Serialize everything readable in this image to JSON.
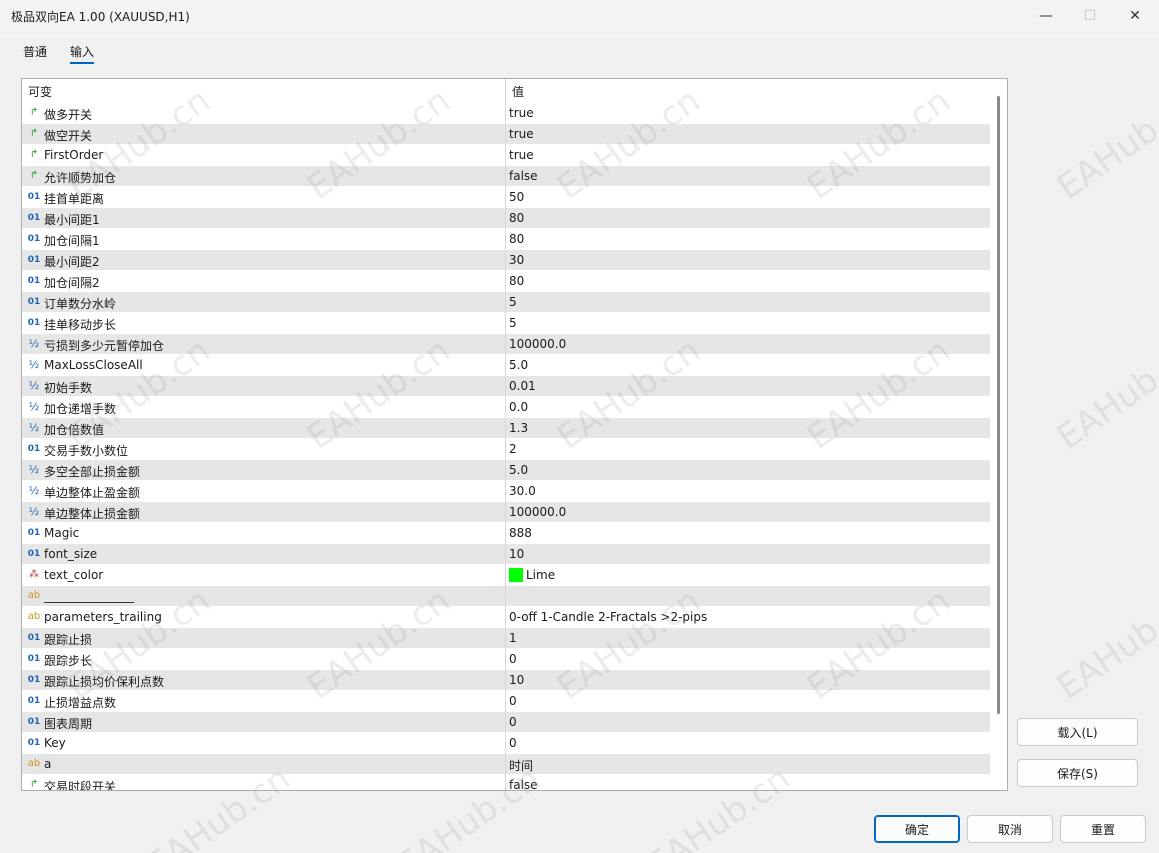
{
  "window": {
    "title": "极品双向EA 1.00 (XAUUSD,H1)",
    "minimize_glyph": "—",
    "maximize_glyph": "☐",
    "close_glyph": "✕"
  },
  "tabs": [
    {
      "label": "普通",
      "active": false
    },
    {
      "label": "输入",
      "active": true
    }
  ],
  "table": {
    "headers": {
      "name": "可变",
      "value": "值"
    },
    "rows": [
      {
        "icon": "bool-icon",
        "glyph": "↱",
        "name": "做多开关",
        "value": "true"
      },
      {
        "icon": "bool-icon",
        "glyph": "↱",
        "name": "做空开关",
        "value": "true"
      },
      {
        "icon": "bool-icon",
        "glyph": "↱",
        "name": "FirstOrder",
        "value": "true"
      },
      {
        "icon": "bool-icon",
        "glyph": "↱",
        "name": "允许顺势加仓",
        "value": "false"
      },
      {
        "icon": "int-icon",
        "glyph": "01",
        "name": "挂首单距离",
        "value": "50"
      },
      {
        "icon": "int-icon",
        "glyph": "01",
        "name": "最小间距1",
        "value": "80"
      },
      {
        "icon": "int-icon",
        "glyph": "01",
        "name": "加仓间隔1",
        "value": "80"
      },
      {
        "icon": "int-icon",
        "glyph": "01",
        "name": "最小间距2",
        "value": "30"
      },
      {
        "icon": "int-icon",
        "glyph": "01",
        "name": "加仓间隔2",
        "value": "80"
      },
      {
        "icon": "int-icon",
        "glyph": "01",
        "name": "订单数分水岭",
        "value": "5"
      },
      {
        "icon": "int-icon",
        "glyph": "01",
        "name": "挂单移动步长",
        "value": "5"
      },
      {
        "icon": "double-icon",
        "glyph": "½",
        "name": "亏损到多少元暂停加仓",
        "value": "100000.0"
      },
      {
        "icon": "double-icon",
        "glyph": "½",
        "name": "MaxLossCloseAll",
        "value": "5.0"
      },
      {
        "icon": "double-icon",
        "glyph": "½",
        "name": "初始手数",
        "value": "0.01"
      },
      {
        "icon": "double-icon",
        "glyph": "½",
        "name": "加仓递增手数",
        "value": "0.0"
      },
      {
        "icon": "double-icon",
        "glyph": "½",
        "name": "加仓倍数值",
        "value": "1.3"
      },
      {
        "icon": "int-icon",
        "glyph": "01",
        "name": "交易手数小数位",
        "value": "2"
      },
      {
        "icon": "double-icon",
        "glyph": "½",
        "name": "多空全部止损金额",
        "value": "5.0"
      },
      {
        "icon": "double-icon",
        "glyph": "½",
        "name": "单边整体止盈金额",
        "value": "30.0"
      },
      {
        "icon": "double-icon",
        "glyph": "½",
        "name": "单边整体止损金额",
        "value": "100000.0"
      },
      {
        "icon": "int-icon",
        "glyph": "01",
        "name": "Magic",
        "value": "888"
      },
      {
        "icon": "int-icon",
        "glyph": "01",
        "name": "font_size",
        "value": "10"
      },
      {
        "icon": "color-icon",
        "glyph": "⁂",
        "name": "text_color",
        "value": "Lime",
        "swatch": "#00ff00"
      },
      {
        "icon": "string-icon",
        "glyph": "ab",
        "name": "_______________",
        "value": ""
      },
      {
        "icon": "string-icon",
        "glyph": "ab",
        "name": "parameters_trailing",
        "value": "0-off  1-Candle  2-Fractals  >2-pips"
      },
      {
        "icon": "int-icon",
        "glyph": "01",
        "name": "跟踪止损",
        "value": "1"
      },
      {
        "icon": "int-icon",
        "glyph": "01",
        "name": "跟踪步长",
        "value": "0"
      },
      {
        "icon": "int-icon",
        "glyph": "01",
        "name": "跟踪止损均价保利点数",
        "value": "10"
      },
      {
        "icon": "int-icon",
        "glyph": "01",
        "name": "止损增益点数",
        "value": "0"
      },
      {
        "icon": "int-icon",
        "glyph": "01",
        "name": "图表周期",
        "value": "0"
      },
      {
        "icon": "int-icon",
        "glyph": "01",
        "name": "Key",
        "value": "0"
      },
      {
        "icon": "string-icon",
        "glyph": "ab",
        "name": "a",
        "value": "时间"
      },
      {
        "icon": "bool-icon",
        "glyph": "↱",
        "name": "交易时段开关",
        "value": "false"
      }
    ]
  },
  "buttons": {
    "load": "载入(L)",
    "save": "保存(S)",
    "ok": "确定",
    "cancel": "取消",
    "reset": "重置"
  },
  "watermark": "EAHub.cn",
  "colors": {
    "accent": "#0067c0",
    "row_alt": "#e6e6e6",
    "lime_swatch": "#00ff00"
  }
}
